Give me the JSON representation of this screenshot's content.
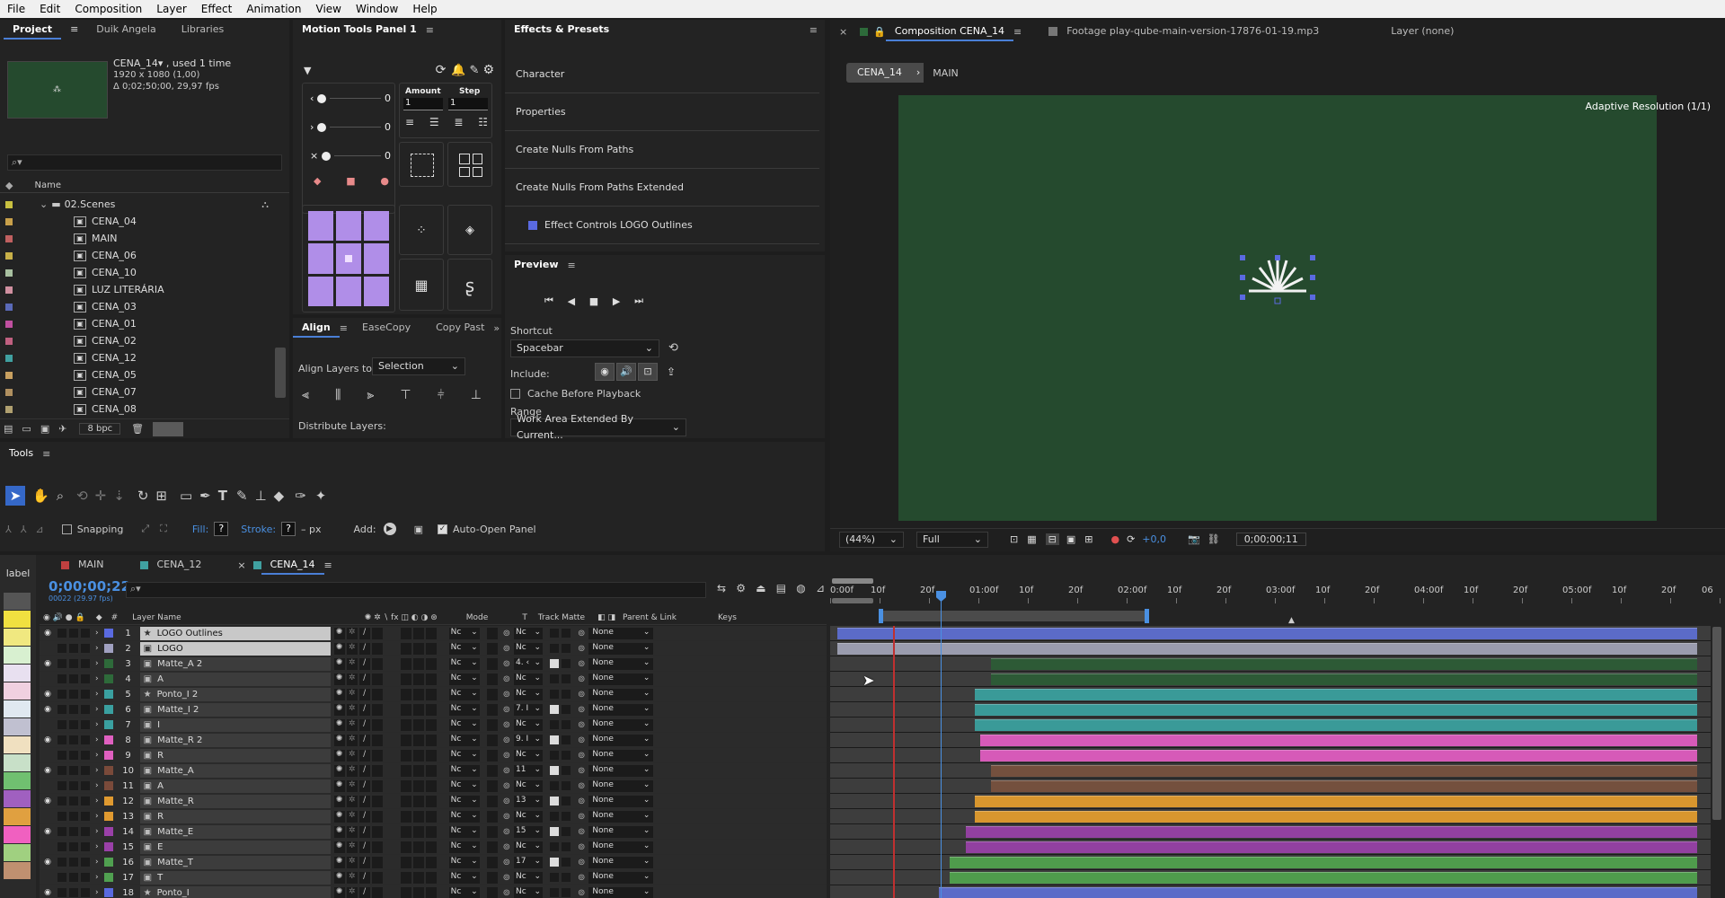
{
  "menu": [
    "File",
    "Edit",
    "Composition",
    "Layer",
    "Effect",
    "Animation",
    "View",
    "Window",
    "Help"
  ],
  "project_panel": {
    "tabs": [
      "Project",
      "Duik Angela",
      "Libraries"
    ],
    "comp_name": "CENA_14▾ , used 1 time",
    "comp_size": "1920 x 1080 (1,00)",
    "comp_duration": "Δ 0;02;50;00, 29,97 fps",
    "search_placeholder": "",
    "column_name": "Name",
    "folder": "02.Scenes",
    "items": [
      {
        "name": "CENA_04",
        "color": "#c8a04a"
      },
      {
        "name": "MAIN",
        "color": "#c06060"
      },
      {
        "name": "CENA_06",
        "color": "#c8b048"
      },
      {
        "name": "CENA_10",
        "color": "#a8c0a0"
      },
      {
        "name": "LUZ LITERÁRIA",
        "color": "#d090a0"
      },
      {
        "name": "CENA_03",
        "color": "#5a6ab8"
      },
      {
        "name": "CENA_01",
        "color": "#c050a0"
      },
      {
        "name": "CENA_02",
        "color": "#c06080"
      },
      {
        "name": "CENA_12",
        "color": "#40a0a0"
      },
      {
        "name": "CENA_05",
        "color": "#c8a060"
      },
      {
        "name": "CENA_07",
        "color": "#b09060"
      },
      {
        "name": "CENA_08",
        "color": "#b0a070"
      }
    ],
    "bpc": "8 bpc"
  },
  "motion_tools": {
    "title": "Motion Tools Panel 1",
    "amount_label": "Amount",
    "step_label": "Step",
    "amount_value": "1",
    "step_value": "1",
    "slider_values": [
      "0",
      "0",
      "0"
    ]
  },
  "align_panel": {
    "tabs": [
      "Align",
      "EaseCopy",
      "Copy Past"
    ],
    "align_to_label": "Align Layers to:",
    "align_to_value": "Selection",
    "distribute_label": "Distribute Layers:"
  },
  "effects": {
    "title": "Effects & Presets",
    "items": [
      "Character",
      "Properties",
      "Create Nulls From Paths",
      "Create Nulls From Paths Extended",
      "Effect Controls LOGO Outlines"
    ]
  },
  "preview": {
    "title": "Preview",
    "shortcut_label": "Shortcut",
    "shortcut_value": "Spacebar",
    "include_label": "Include:",
    "cache_label": "Cache Before Playback",
    "range_label": "Range",
    "range_value": "Work Area Extended By Current..."
  },
  "tools": {
    "title": "Tools",
    "snapping": "Snapping",
    "fill": "Fill:",
    "fill_value": "?",
    "stroke": "Stroke:",
    "stroke_value": "?",
    "stroke_px": "– px",
    "add": "Add:",
    "auto_open": "Auto-Open Panel"
  },
  "composition": {
    "tab_label": "Composition CENA_14",
    "footage_tab": "Footage play-qube-main-version-17876-01-19.mp3",
    "layer_tab": "Layer (none)",
    "breadcrumb": [
      "CENA_14",
      "MAIN"
    ],
    "adaptive": "Adaptive Resolution (1/1)",
    "zoom": "(44%)",
    "resolution": "Full",
    "exposure": "+0,0",
    "timecode": "0;00;00;11",
    "bg_color": "#254a2e"
  },
  "timeline": {
    "tabs": [
      "MAIN",
      "CENA_12",
      "CENA_14"
    ],
    "tab_colors": [
      "#c04040",
      "#40a0a0",
      "#40a0a0"
    ],
    "timecode": "0;00;00;22",
    "frame_info": "00022 (29.97 fps)",
    "label_col": "label",
    "columns": {
      "layer_name": "Layer Name",
      "mode": "Mode",
      "t": "T",
      "track_matte": "Track Matte",
      "parent": "Parent & Link",
      "keys": "Keys"
    },
    "ruler": [
      "0:00f",
      "10f",
      "20f",
      "01:00f",
      "10f",
      "20f",
      "02:00f",
      "10f",
      "20f",
      "03:00f",
      "10f",
      "20f",
      "04:00f",
      "10f",
      "20f",
      "05:00f",
      "10f",
      "20f",
      "06"
    ],
    "layers": [
      {
        "num": "1",
        "name": "LOGO Outlines",
        "type": "star",
        "label": "#5a6ae0",
        "matte": "Nc",
        "parent": "None",
        "eye": true,
        "bar_color": "#5b6bc8",
        "bar_start": 0.0,
        "selected": true
      },
      {
        "num": "2",
        "name": "LOGO",
        "type": "comp",
        "label": "#a0a0c0",
        "matte": "Nc",
        "parent": "None",
        "eye": false,
        "bar_color": "#9a9cae",
        "bar_start": 0.0,
        "selected": true
      },
      {
        "num": "3",
        "name": "Matte_A 2",
        "type": "comp",
        "label": "#2e6a3a",
        "matte": "4. ‹",
        "parent": "None",
        "eye": true,
        "bar_color": "#2d5a36",
        "bar_start": 0.174,
        "selected": false
      },
      {
        "num": "4",
        "name": "A",
        "type": "comp",
        "label": "#2e6a3a",
        "matte": "Nc",
        "parent": "None",
        "eye": false,
        "bar_color": "#2d5a36",
        "bar_start": 0.174,
        "selected": false
      },
      {
        "num": "5",
        "name": "Ponto_I 2",
        "type": "star",
        "label": "#3aa0a0",
        "matte": "Nc",
        "parent": "None",
        "eye": true,
        "bar_color": "#3a9a98",
        "bar_start": 0.156,
        "selected": false
      },
      {
        "num": "6",
        "name": "Matte_I 2",
        "type": "comp",
        "label": "#3aa0a0",
        "matte": "7. I",
        "parent": "None",
        "eye": true,
        "bar_color": "#3a9a98",
        "bar_start": 0.156,
        "selected": false
      },
      {
        "num": "7",
        "name": "I",
        "type": "comp",
        "label": "#3aa0a0",
        "matte": "Nc",
        "parent": "None",
        "eye": false,
        "bar_color": "#3a9a98",
        "bar_start": 0.156,
        "selected": false
      },
      {
        "num": "8",
        "name": "Matte_R 2",
        "type": "comp",
        "label": "#e060c0",
        "matte": "9. I",
        "parent": "None",
        "eye": true,
        "bar_color": "#d65ab8",
        "bar_start": 0.162,
        "selected": false
      },
      {
        "num": "9",
        "name": "R",
        "type": "comp",
        "label": "#e060c0",
        "matte": "Nc",
        "parent": "None",
        "eye": false,
        "bar_color": "#d65ab8",
        "bar_start": 0.162,
        "selected": false
      },
      {
        "num": "10",
        "name": "Matte_A",
        "type": "comp",
        "label": "#7a4a3a",
        "matte": "11",
        "parent": "None",
        "eye": true,
        "bar_color": "#74503e",
        "bar_start": 0.174,
        "selected": false
      },
      {
        "num": "11",
        "name": "A",
        "type": "comp",
        "label": "#7a4a3a",
        "matte": "Nc",
        "parent": "None",
        "eye": false,
        "bar_color": "#74503e",
        "bar_start": 0.174,
        "selected": false
      },
      {
        "num": "12",
        "name": "Matte_R",
        "type": "comp",
        "label": "#e09a30",
        "matte": "13",
        "parent": "None",
        "eye": true,
        "bar_color": "#d8962e",
        "bar_start": 0.156,
        "selected": false
      },
      {
        "num": "13",
        "name": "R",
        "type": "comp",
        "label": "#e09a30",
        "matte": "Nc",
        "parent": "None",
        "eye": false,
        "bar_color": "#d8962e",
        "bar_start": 0.156,
        "selected": false
      },
      {
        "num": "14",
        "name": "Matte_E",
        "type": "comp",
        "label": "#9a40a8",
        "matte": "15",
        "parent": "None",
        "eye": true,
        "bar_color": "#9240a0",
        "bar_start": 0.146,
        "selected": false
      },
      {
        "num": "15",
        "name": "E",
        "type": "comp",
        "label": "#9a40a8",
        "matte": "Nc",
        "parent": "None",
        "eye": false,
        "bar_color": "#9240a0",
        "bar_start": 0.146,
        "selected": false
      },
      {
        "num": "16",
        "name": "Matte_T",
        "type": "comp",
        "label": "#50a050",
        "matte": "17",
        "parent": "None",
        "eye": true,
        "bar_color": "#4f9c4c",
        "bar_start": 0.128,
        "selected": false
      },
      {
        "num": "17",
        "name": "T",
        "type": "comp",
        "label": "#50a050",
        "matte": "Nc",
        "parent": "None",
        "eye": false,
        "bar_color": "#4f9c4c",
        "bar_start": 0.128,
        "selected": false
      },
      {
        "num": "18",
        "name": "Ponto_I",
        "type": "star",
        "label": "#5a6ae0",
        "matte": "Nc",
        "parent": "None",
        "eye": true,
        "bar_color": "#5b6bc8",
        "bar_start": 0.115,
        "selected": false
      }
    ],
    "label_swatches": [
      "#555555",
      "#f0e040",
      "#f0e880",
      "#d8f0d0",
      "#e8e0f0",
      "#f0d0e0",
      "#e0e8f0",
      "#c0c0d0",
      "#f0e0c0",
      "#c8e0c8",
      "#70c070",
      "#a060c0",
      "#e0a040",
      "#f060c0",
      "#a0d080",
      "#c09070"
    ],
    "mode_label": "Nc"
  }
}
